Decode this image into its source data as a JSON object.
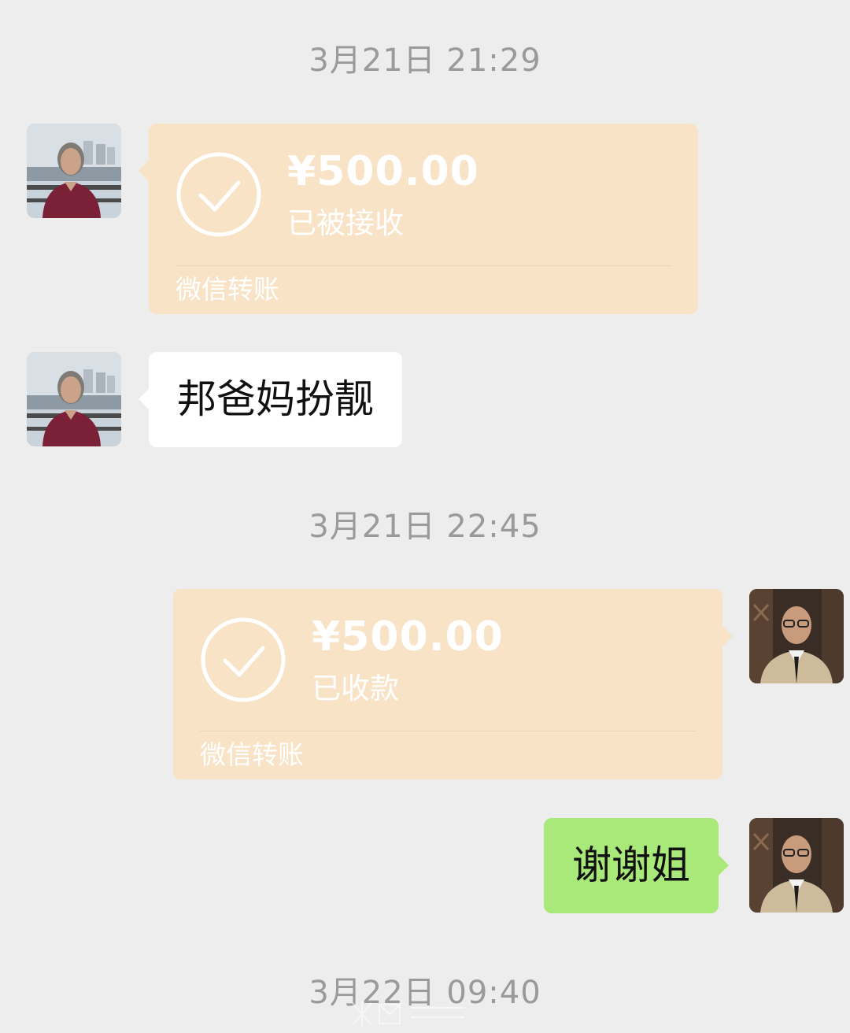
{
  "timestamps": [
    "3月21日 21:29",
    "3月21日 22:45",
    "3月22日 09:40"
  ],
  "messages": {
    "transfer_received": {
      "amount": "¥500.00",
      "status": "已被接收",
      "footer": "微信转账"
    },
    "text_left": "邦爸妈扮靓",
    "transfer_sent": {
      "amount": "¥500.00",
      "status": "已收款",
      "footer": "微信转账"
    },
    "text_right": "谢谢姐"
  },
  "colors": {
    "background": "#ededed",
    "transfer_bubble": "#f8e3c7",
    "sent_bubble": "#a9e97a",
    "received_bubble": "#ffffff",
    "timestamp_text": "#9a9a9a"
  },
  "icons": {
    "transfer_status": "check-circle-icon"
  }
}
